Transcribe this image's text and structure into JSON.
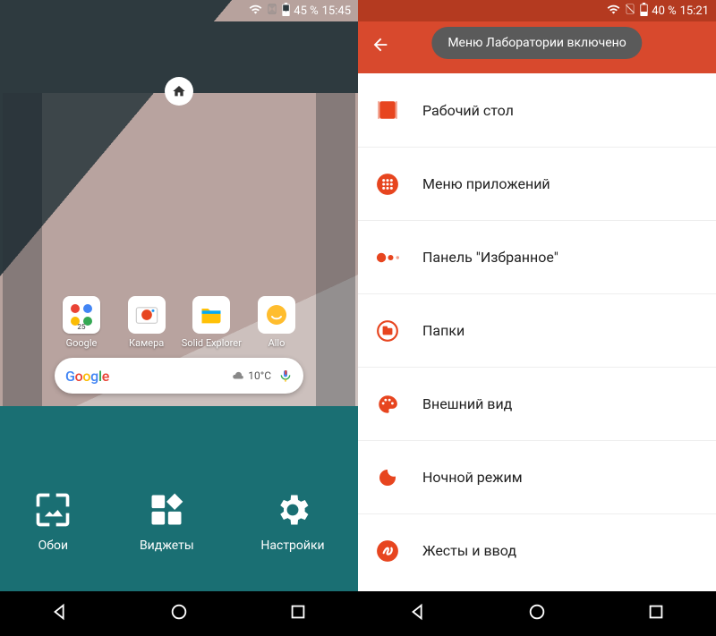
{
  "left": {
    "status": {
      "battery": "45 %",
      "time": "15:45"
    },
    "apps": [
      {
        "label": "Google"
      },
      {
        "label": "Камера"
      },
      {
        "label": "Solid Explorer"
      },
      {
        "label": "Allo"
      }
    ],
    "search": {
      "logo": "Google",
      "weather_temp": "10°C"
    },
    "options": [
      {
        "label": "Обои"
      },
      {
        "label": "Виджеты"
      },
      {
        "label": "Настройки"
      }
    ]
  },
  "right": {
    "status": {
      "battery": "40 %",
      "time": "15:21"
    },
    "toast": "Меню Лаборатории включено",
    "settings": [
      {
        "icon": "desktop",
        "label": "Рабочий стол"
      },
      {
        "icon": "apps-grid",
        "label": "Меню приложений"
      },
      {
        "icon": "dots",
        "label": "Панель \"Избранное\""
      },
      {
        "icon": "folder",
        "label": "Папки"
      },
      {
        "icon": "palette",
        "label": "Внешний вид"
      },
      {
        "icon": "moon",
        "label": "Ночной режим"
      },
      {
        "icon": "gesture",
        "label": "Жесты и ввод"
      }
    ]
  }
}
